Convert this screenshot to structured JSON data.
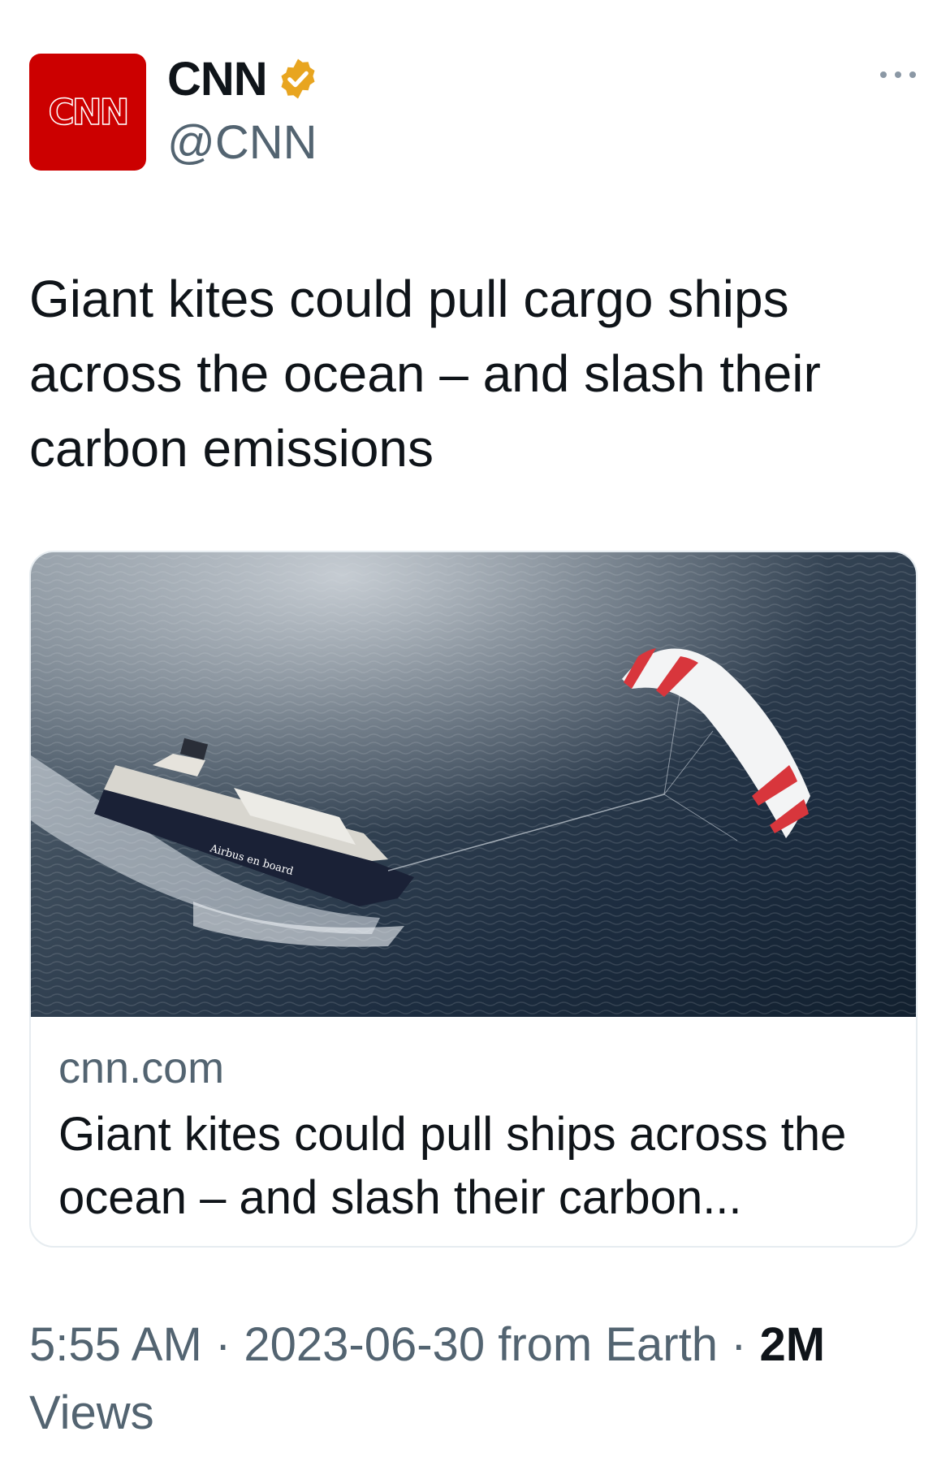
{
  "account": {
    "display_name": "CNN",
    "handle": "@CNN",
    "avatar_text": "CNN",
    "verified_color": "#e8a520",
    "brand_color": "#cc0000"
  },
  "tweet": {
    "text": "Giant kites could pull cargo ships across the ocean – and slash their carbon emissions"
  },
  "card": {
    "image_hull_text": "Airbus en board",
    "domain": "cnn.com",
    "title": "Giant kites could pull ships across the ocean – and slash their carbon..."
  },
  "footer": {
    "time": "5:55 AM",
    "separator": "·",
    "date": "2023-06-30",
    "source": "from Earth",
    "views_count": "2M",
    "views_label": "Views"
  },
  "icons": {
    "more": "more-horizontal-icon",
    "verified": "verified-badge-icon"
  }
}
